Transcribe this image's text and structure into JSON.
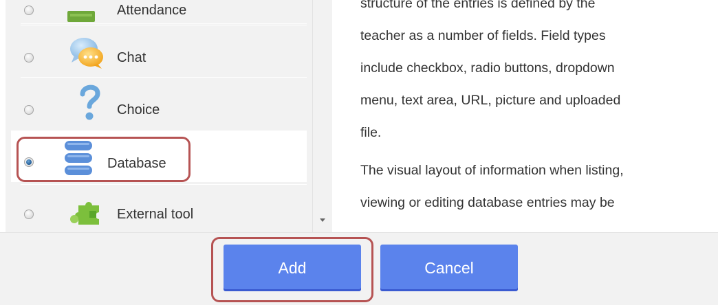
{
  "activities": [
    {
      "label": "Attendance",
      "icon": "attendance-icon",
      "selected": false
    },
    {
      "label": "Chat",
      "icon": "chat-icon",
      "selected": false
    },
    {
      "label": "Choice",
      "icon": "choice-icon",
      "selected": false
    },
    {
      "label": "Database",
      "icon": "database-icon",
      "selected": true
    },
    {
      "label": "External tool",
      "icon": "external-tool-icon",
      "selected": false
    }
  ],
  "description": {
    "lines_first": [
      "structure of the entries is defined by the",
      "teacher as a number of fields. Field types",
      "include checkbox, radio buttons, dropdown",
      "menu, text area, URL, picture and uploaded",
      "file."
    ],
    "lines_second": [
      "The visual layout of information when listing,",
      "viewing or editing database entries may be"
    ]
  },
  "buttons": {
    "add_label": "Add",
    "cancel_label": "Cancel"
  },
  "colors": {
    "button_blue": "#5b83ec",
    "highlight_red": "#b65353",
    "panel_gray": "#f2f2f2"
  }
}
